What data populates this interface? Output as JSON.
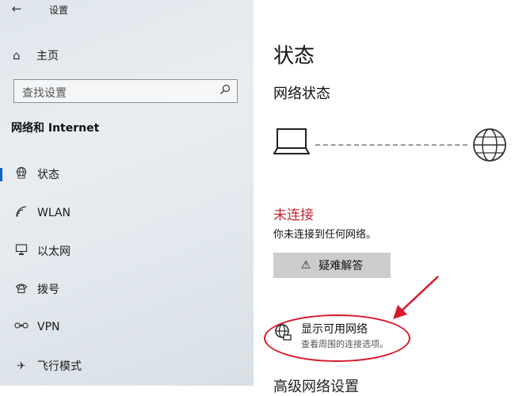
{
  "titlebar": {
    "back_icon": "back-arrow-icon",
    "title": "设置"
  },
  "home": {
    "icon": "home-icon",
    "label": "主页"
  },
  "search": {
    "placeholder": "查找设置",
    "icon": "search-icon"
  },
  "sidebar": {
    "section_title": "网络和 Internet",
    "items": [
      {
        "icon": "status-icon",
        "label": "状态",
        "active": true
      },
      {
        "icon": "wlan-icon",
        "label": "WLAN",
        "active": false
      },
      {
        "icon": "ethernet-icon",
        "label": "以太网",
        "active": false
      },
      {
        "icon": "dialup-icon",
        "label": "拨号",
        "active": false
      },
      {
        "icon": "vpn-icon",
        "label": "VPN",
        "active": false
      },
      {
        "icon": "airplane-icon",
        "label": "飞行模式",
        "active": false
      }
    ]
  },
  "main": {
    "title": "状态",
    "network_status_title": "网络状态",
    "status_label": "未连接",
    "status_desc": "你未连接到任何网络。",
    "troubleshoot": {
      "icon": "warning-icon",
      "label": "疑难解答"
    },
    "show_networks": {
      "icon": "network-globe-icon",
      "name": "显示可用网络",
      "desc": "查看周围的连接选项。"
    },
    "next_heading": "高级网络设置"
  },
  "colors": {
    "accent": "#0a62c9",
    "error": "#c4262e",
    "annotation": "#d7192b"
  }
}
